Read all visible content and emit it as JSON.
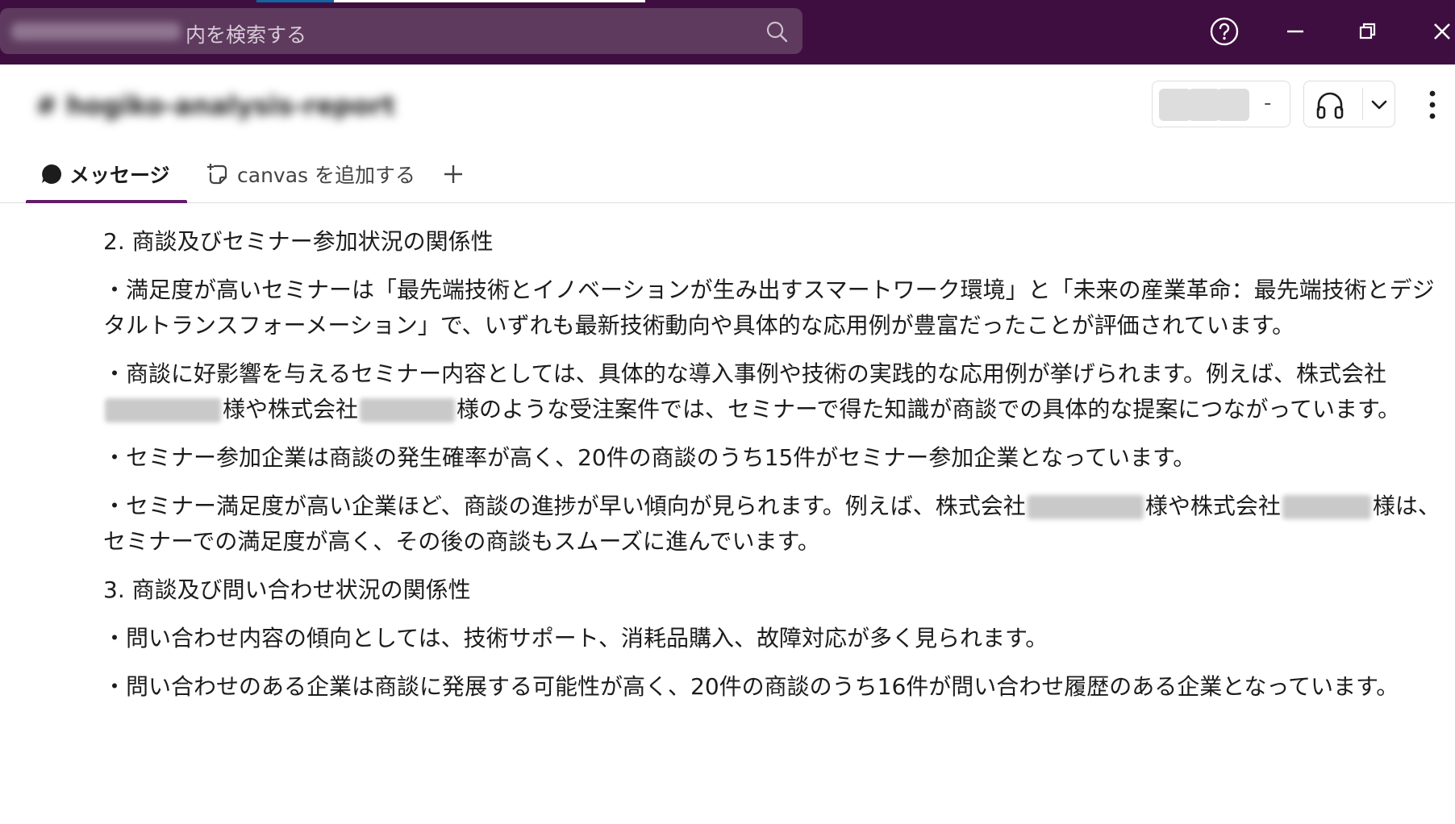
{
  "titlebar": {
    "search_placeholder": "内を検索する",
    "search_workspace_redacted": "Selcom Technology",
    "icons": [
      "search-icon",
      "help-icon",
      "minimize-icon",
      "restore-icon",
      "close-icon"
    ]
  },
  "channel": {
    "name_redacted": "# hogiko-analysis-report",
    "member_count": "-"
  },
  "tabs": {
    "messages_label": "メッセージ",
    "canvas_label": "canvas を追加する",
    "add_label": "+"
  },
  "message": {
    "section2_heading": "2. 商談及びセミナー参加状況の関係性",
    "section2_p1": "・満足度が高いセミナーは「最先端技術とイノベーションが生み出すスマートワーク環境」と「未来の産業革命：最先端技術とデジタルトランスフォーメーション」で、いずれも最新技術動向や具体的な応用例が豊富だったことが評価されています。",
    "section2_p2_a": "・商談に好影響を与えるセミナー内容としては、具体的な導入事例や技術の実践的な応用例が挙げられます。例えば、株式会社",
    "section2_p2_b": "様や株式会社",
    "section2_p2_c": "様のような受注案件では、セミナーで得た知識が商談での具体的な提案につながっています。",
    "section2_p3": "・セミナー参加企業は商談の発生確率が高く、20件の商談のうち15件がセミナー参加企業となっています。",
    "section2_p4_a": "・セミナー満足度が高い企業ほど、商談の進捗が早い傾向が見られます。例えば、株式会社",
    "section2_p4_b": "様や株式会社",
    "section2_p4_c": "様は、セミナーでの満足度が高く、その後の商談もスムーズに進んでいます。",
    "section3_heading": "3. 商談及び問い合わせ状況の関係性",
    "section3_p1": "・問い合わせ内容の傾向としては、技術サポート、消耗品購入、故障対応が多く見られます。",
    "section3_p2": "・問い合わせのある企業は商談に発展する可能性が高く、20件の商談のうち16件が問い合わせ履歴のある企業となっています。"
  },
  "colors": {
    "titlebar": "#3f0e40",
    "search_bg": "#5d3a5e",
    "accent": "#611f69",
    "text": "#1d1c1d"
  }
}
